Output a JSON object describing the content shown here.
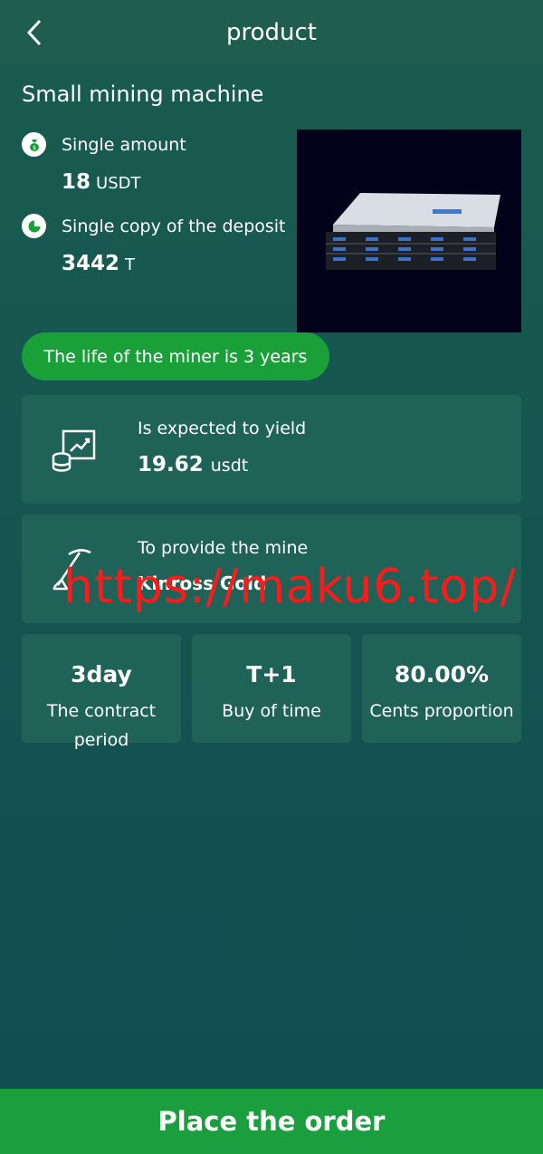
{
  "header": {
    "title": "product"
  },
  "product": {
    "name": "Small mining machine",
    "single_amount_label": "Single amount",
    "single_amount_value": "18",
    "single_amount_unit": "USDT",
    "deposit_label": "Single copy of the deposit",
    "deposit_value": "3442",
    "deposit_unit": "T",
    "life_text": "The life of the miner is 3 years"
  },
  "yield_card": {
    "label": "Is expected to yield",
    "value": "19.62",
    "unit": "usdt"
  },
  "mine_card": {
    "label": "To provide the mine",
    "value": "Kinross Gold"
  },
  "stats": [
    {
      "value": "3day",
      "label": "The contract period"
    },
    {
      "value": "T+1",
      "label": "Buy of time"
    },
    {
      "value": "80.00%",
      "label": "Cents proportion"
    }
  ],
  "watermark": "https://maku6.top/",
  "order_button": "Place the order",
  "colors": {
    "accent_green": "#1aa038",
    "card_bg": "#1f6257",
    "watermark_red": "#ff1a1a"
  }
}
